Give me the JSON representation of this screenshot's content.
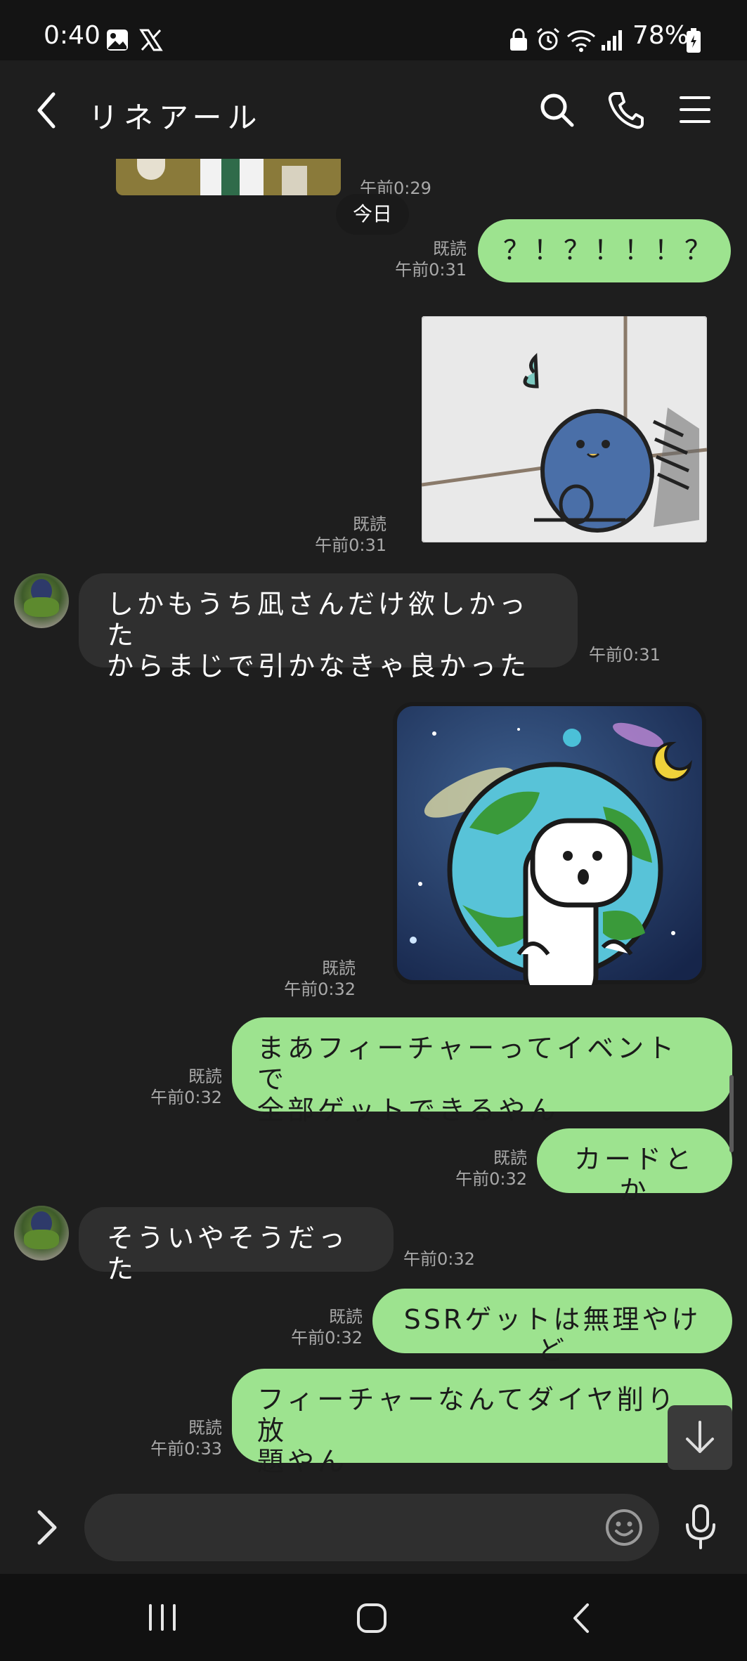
{
  "status_bar": {
    "time": "0:40",
    "battery": "78%",
    "icons": [
      "gallery-icon",
      "x-logo-icon",
      "lock-icon",
      "alarm-icon",
      "wifi-icon",
      "signal-icon",
      "battery-icon"
    ]
  },
  "header": {
    "title": "リネアール",
    "icons": [
      "back-icon",
      "search-icon",
      "phone-icon",
      "menu-icon"
    ]
  },
  "chat": {
    "date_divider": "今日",
    "messages": [
      {
        "dir": "in",
        "type": "sticker",
        "time": "午前0:29"
      },
      {
        "dir": "out",
        "type": "text",
        "text": "？！？！！！？",
        "read": "既読",
        "time": "午前0:31"
      },
      {
        "dir": "out",
        "type": "sticker",
        "read": "既読",
        "time": "午前0:31"
      },
      {
        "dir": "in",
        "type": "text",
        "line1": "しかもうち凪さんだけ欲しかった",
        "line2": "からまじで引かなきゃ良かった",
        "time": "午前0:31"
      },
      {
        "dir": "out",
        "type": "sticker",
        "read": "既読",
        "time": "午前0:32"
      },
      {
        "dir": "out",
        "type": "text",
        "line1": "まあフィーチャーってイベントで",
        "line2": "全部ゲットできるやん",
        "read": "既読",
        "time": "午前0:32"
      },
      {
        "dir": "out",
        "type": "text",
        "text": "カードとか",
        "read": "既読",
        "time": "午前0:32"
      },
      {
        "dir": "in",
        "type": "text",
        "text": "そういやそうだった",
        "time": "午前0:32"
      },
      {
        "dir": "out",
        "type": "text",
        "text": "SSRゲットは無理やけど",
        "read": "既読",
        "time": "午前0:32"
      },
      {
        "dir": "out",
        "type": "text",
        "line1": "フィーチャーなんてダイヤ削り放",
        "line2": "題やん",
        "read": "既読",
        "time": "午前0:33"
      }
    ]
  },
  "input": {
    "placeholder": "",
    "icons": [
      "expand-icon",
      "emoji-icon",
      "mic-icon"
    ]
  },
  "nav": {
    "icons": [
      "recents-icon",
      "home-icon",
      "back-nav-icon"
    ]
  },
  "colors": {
    "background": "#1e1e1e",
    "outgoing_bubble": "#9de38f",
    "incoming_bubble": "#2f2f2f",
    "meta_text": "#a9a9a9"
  }
}
